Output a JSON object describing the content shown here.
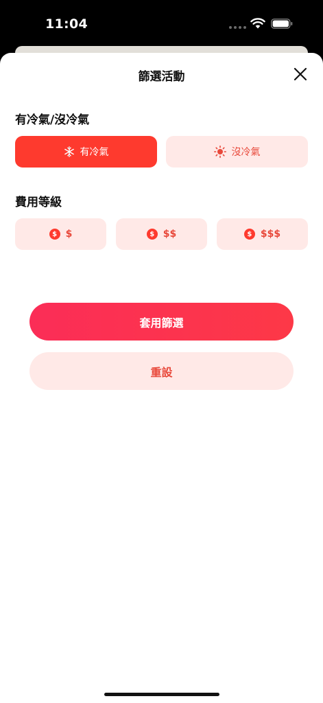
{
  "status_bar": {
    "time": "11:04"
  },
  "sheet": {
    "title": "篩選活動"
  },
  "ac_section": {
    "label": "有冷氣/沒冷氣",
    "options": [
      {
        "label": "有冷氣",
        "icon": "snowflake-icon",
        "selected": true
      },
      {
        "label": "沒冷氣",
        "icon": "sun-icon",
        "selected": false
      }
    ]
  },
  "price_section": {
    "label": "費用等級",
    "options": [
      {
        "label": "$",
        "icon": "coin-icon"
      },
      {
        "label": "$$",
        "icon": "coin-icon"
      },
      {
        "label": "$$$",
        "icon": "coin-icon"
      }
    ],
    "coin_symbol": "$"
  },
  "actions": {
    "apply_label": "套用篩選",
    "reset_label": "重設"
  },
  "colors": {
    "accent": "#fe3a2e",
    "accent_light": "#ffe9e7",
    "accent_text": "#e8483a"
  }
}
